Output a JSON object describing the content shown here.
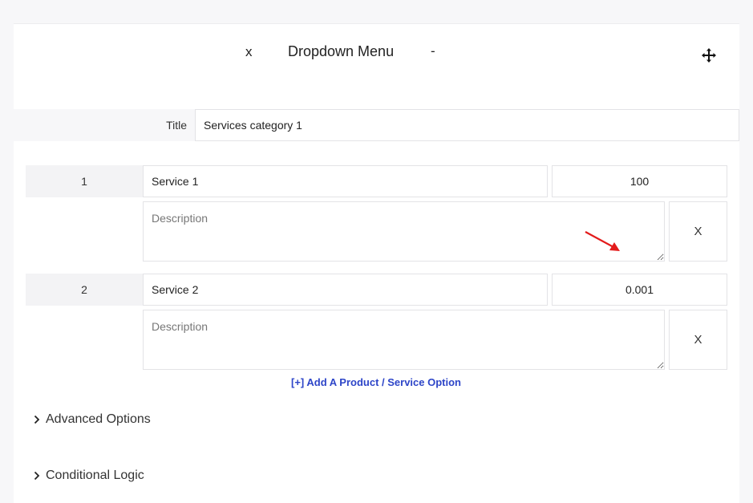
{
  "header": {
    "close_label": "x",
    "title": "Dropdown Menu",
    "minimize_label": "-",
    "move_icon": "move-arrows-icon"
  },
  "title_field": {
    "label": "Title",
    "value": "Services category 1"
  },
  "services": [
    {
      "number": "1",
      "name": "Service 1",
      "price": "100",
      "description_placeholder": "Description",
      "remove_label": "X"
    },
    {
      "number": "2",
      "name": "Service 2",
      "price": "0.001",
      "description_placeholder": "Description",
      "remove_label": "X"
    }
  ],
  "add_option_label": "[+] Add A Product / Service Option",
  "sections": [
    {
      "label": "Advanced Options",
      "icon": "chevron-right-icon"
    },
    {
      "label": "Conditional Logic",
      "icon": "chevron-right-icon"
    }
  ],
  "colors": {
    "accent_link": "#2d45c8",
    "annotation_arrow": "#e31b1b",
    "cell_background": "#f3f3f5"
  }
}
